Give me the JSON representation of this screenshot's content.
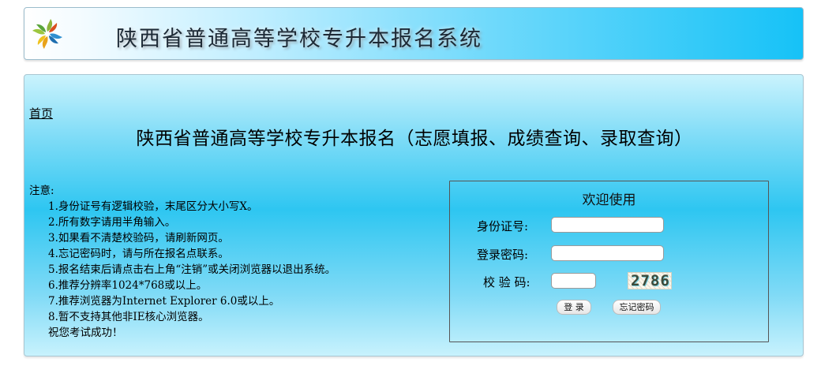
{
  "header": {
    "logo_icon": "pinwheel-logo-icon",
    "title": "陕西省普通高等学校专升本报名系统"
  },
  "main": {
    "home_link": "首页",
    "page_title": "陕西省普通高等学校专升本报名（志愿填报、成绩查询、录取查询）"
  },
  "notice": {
    "label": "注意:",
    "items": [
      "1.身份证号有逻辑校验，末尾区分大小写X。",
      "2.所有数字请用半角输入。",
      "3.如果看不清楚校验码，请刷新网页。",
      "4.忘记密码时，请与所在报名点联系。",
      "5.报名结束后请点击右上角“注销”或关闭浏览器以退出系统。",
      "6.推荐分辨率1024*768或以上。",
      "7.推荐浏览器为Internet Explorer 6.0或以上。",
      "8.暂不支持其他非IE核心浏览器。",
      "祝您考试成功！"
    ]
  },
  "login": {
    "heading": "欢迎使用",
    "id_label": "身份证号:",
    "id_value": "",
    "password_label": "登录密码:",
    "password_value": "",
    "captcha_label": "校 验 码:",
    "captcha_value": "",
    "captcha_image_text": "2786",
    "login_button": "登 录",
    "forgot_button": "忘记密码"
  }
}
